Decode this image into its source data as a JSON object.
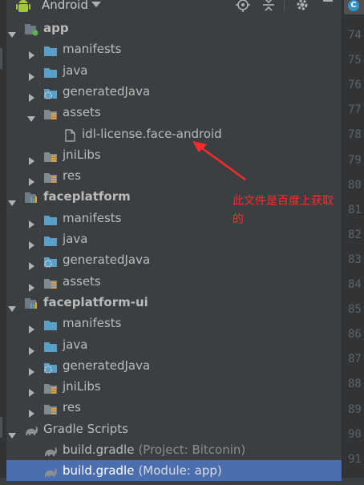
{
  "toolbar": {
    "title": "Android",
    "icons": [
      "android-icon",
      "chevron-down-icon",
      "target-icon",
      "collapse-icon",
      "gear-icon",
      "minimize-icon"
    ]
  },
  "tree": [
    {
      "label": "app",
      "level": 0,
      "expanded": true,
      "bold": true,
      "icon": "module-icon"
    },
    {
      "label": "manifests",
      "level": 1,
      "expanded": false,
      "icon": "folder-icon"
    },
    {
      "label": "java",
      "level": 1,
      "expanded": false,
      "icon": "folder-icon"
    },
    {
      "label": "generatedJava",
      "level": 1,
      "expanded": false,
      "icon": "generated-folder-icon"
    },
    {
      "label": "assets",
      "level": 1,
      "expanded": true,
      "icon": "resource-folder-icon"
    },
    {
      "label": "idl-license.face-android",
      "level": 2,
      "expanded": null,
      "icon": "file-icon"
    },
    {
      "label": "jniLibs",
      "level": 1,
      "expanded": false,
      "icon": "resource-folder-icon"
    },
    {
      "label": "res",
      "level": 1,
      "expanded": false,
      "icon": "resource-folder-icon"
    },
    {
      "label": "faceplatform",
      "level": 0,
      "expanded": true,
      "bold": true,
      "icon": "library-module-icon"
    },
    {
      "label": "manifests",
      "level": 1,
      "expanded": false,
      "icon": "folder-icon"
    },
    {
      "label": "java",
      "level": 1,
      "expanded": false,
      "icon": "folder-icon"
    },
    {
      "label": "generatedJava",
      "level": 1,
      "expanded": false,
      "icon": "generated-folder-icon"
    },
    {
      "label": "assets",
      "level": 1,
      "expanded": false,
      "icon": "resource-folder-icon"
    },
    {
      "label": "faceplatform-ui",
      "level": 0,
      "expanded": true,
      "bold": true,
      "icon": "library-module-icon"
    },
    {
      "label": "manifests",
      "level": 1,
      "expanded": false,
      "icon": "folder-icon"
    },
    {
      "label": "java",
      "level": 1,
      "expanded": false,
      "icon": "folder-icon"
    },
    {
      "label": "generatedJava",
      "level": 1,
      "expanded": false,
      "icon": "generated-folder-icon"
    },
    {
      "label": "jniLibs",
      "level": 1,
      "expanded": false,
      "icon": "resource-folder-icon"
    },
    {
      "label": "res",
      "level": 1,
      "expanded": false,
      "icon": "resource-folder-icon"
    },
    {
      "label": "Gradle Scripts",
      "level": 0,
      "expanded": true,
      "icon": "gradle-icon"
    },
    {
      "label": "build.gradle",
      "hint": "(Project: Bitconin)",
      "level": 1,
      "expanded": null,
      "icon": "gradle-file-icon"
    },
    {
      "label": "build.gradle",
      "hint": "(Module: app)",
      "level": 1,
      "expanded": null,
      "icon": "gradle-file-icon",
      "selected": true
    }
  ],
  "gutter": {
    "tab_letter": "C",
    "line_numbers": [
      "74",
      "75",
      "76",
      "77",
      "78",
      "79",
      "80",
      "81",
      "82",
      "83",
      "84",
      "85",
      "86",
      "87",
      "88",
      "89",
      "90",
      "91"
    ]
  },
  "annotation": {
    "line1": "此文件是百度上获取",
    "line2": "的"
  },
  "colors": {
    "background": "#3c3f41",
    "selection": "#4b6eaf",
    "folder": "#5a9fc7",
    "annotation": "#ff2a2a"
  }
}
